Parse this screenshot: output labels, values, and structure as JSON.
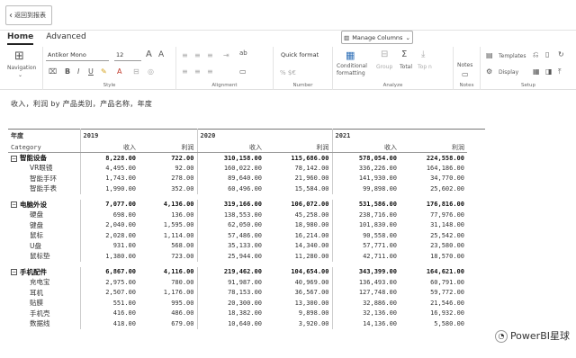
{
  "back_button": "返回到报表",
  "tabs": [
    "Home",
    "Advanced"
  ],
  "ribbon": {
    "navigation_label": "Navigation",
    "font_name": "Antikor Mono",
    "font_size": "12",
    "style_group": "Style",
    "alignment_group": "Alignment",
    "number_group": "Number",
    "quick_format": "Quick format",
    "number_symbols": "% $€",
    "analyze_group": "Analyze",
    "conditional_formatting": "Conditional formatting",
    "group_btn": "Group",
    "total_btn": "Total",
    "topn_btn": "Top n",
    "notes_btn": "Notes",
    "notes_group": "Notes",
    "templates_btn": "Templates",
    "display_btn": "Display",
    "setup_group": "Setup",
    "manage_columns": "Manage Columns"
  },
  "caption": "收入，利润 by 产品类别，产品名称，年度",
  "matrix": {
    "year_header": "年度",
    "row_header": "Category",
    "years": [
      "2019",
      "2020",
      "2021"
    ],
    "measures": [
      "收入",
      "利润"
    ],
    "groups": [
      {
        "name": "智能设备",
        "values": [
          "8,228.00",
          "722.00",
          "310,158.00",
          "115,686.00",
          "578,054.00",
          "224,558.00"
        ],
        "rows": [
          {
            "name": "VR眼镜",
            "values": [
              "4,495.00",
              "92.00",
              "160,022.00",
              "78,142.00",
              "336,226.00",
              "164,186.00"
            ]
          },
          {
            "name": "智能手环",
            "values": [
              "1,743.00",
              "278.00",
              "89,640.00",
              "21,960.00",
              "141,930.00",
              "34,770.00"
            ]
          },
          {
            "name": "智能手表",
            "values": [
              "1,990.00",
              "352.00",
              "60,496.00",
              "15,584.00",
              "99,898.00",
              "25,602.00"
            ]
          }
        ]
      },
      {
        "name": "电脑外设",
        "values": [
          "7,077.00",
          "4,136.00",
          "319,166.00",
          "106,072.00",
          "531,586.00",
          "176,816.00"
        ],
        "rows": [
          {
            "name": "硬盘",
            "values": [
              "698.00",
              "136.00",
              "138,553.00",
              "45,258.00",
              "238,716.00",
              "77,976.00"
            ]
          },
          {
            "name": "键盘",
            "values": [
              "2,040.00",
              "1,595.00",
              "62,050.00",
              "18,980.00",
              "101,830.00",
              "31,148.00"
            ]
          },
          {
            "name": "鼠标",
            "values": [
              "2,028.00",
              "1,114.00",
              "57,486.00",
              "16,214.00",
              "90,558.00",
              "25,542.00"
            ]
          },
          {
            "name": "U盘",
            "values": [
              "931.00",
              "568.00",
              "35,133.00",
              "14,340.00",
              "57,771.00",
              "23,580.00"
            ]
          },
          {
            "name": "鼠标垫",
            "values": [
              "1,380.00",
              "723.00",
              "25,944.00",
              "11,280.00",
              "42,711.00",
              "18,570.00"
            ]
          }
        ]
      },
      {
        "name": "手机配件",
        "values": [
          "6,867.00",
          "4,116.00",
          "219,462.00",
          "104,654.00",
          "343,399.00",
          "164,621.00"
        ],
        "rows": [
          {
            "name": "充电宝",
            "values": [
              "2,975.00",
              "780.00",
              "91,987.00",
              "40,969.00",
              "136,493.00",
              "60,791.00"
            ]
          },
          {
            "name": "耳机",
            "values": [
              "2,507.00",
              "1,176.00",
              "78,153.00",
              "36,567.00",
              "127,748.00",
              "59,772.00"
            ]
          },
          {
            "name": "贴膜",
            "values": [
              "551.00",
              "995.00",
              "20,300.00",
              "13,300.00",
              "32,886.00",
              "21,546.00"
            ]
          },
          {
            "name": "手机壳",
            "values": [
              "416.00",
              "486.00",
              "18,382.00",
              "9,898.00",
              "32,136.00",
              "16,932.00"
            ]
          },
          {
            "name": "数据线",
            "values": [
              "418.00",
              "679.00",
              "10,640.00",
              "3,920.00",
              "14,136.00",
              "5,580.00"
            ]
          }
        ]
      }
    ]
  },
  "watermark": "PowerBI星球"
}
